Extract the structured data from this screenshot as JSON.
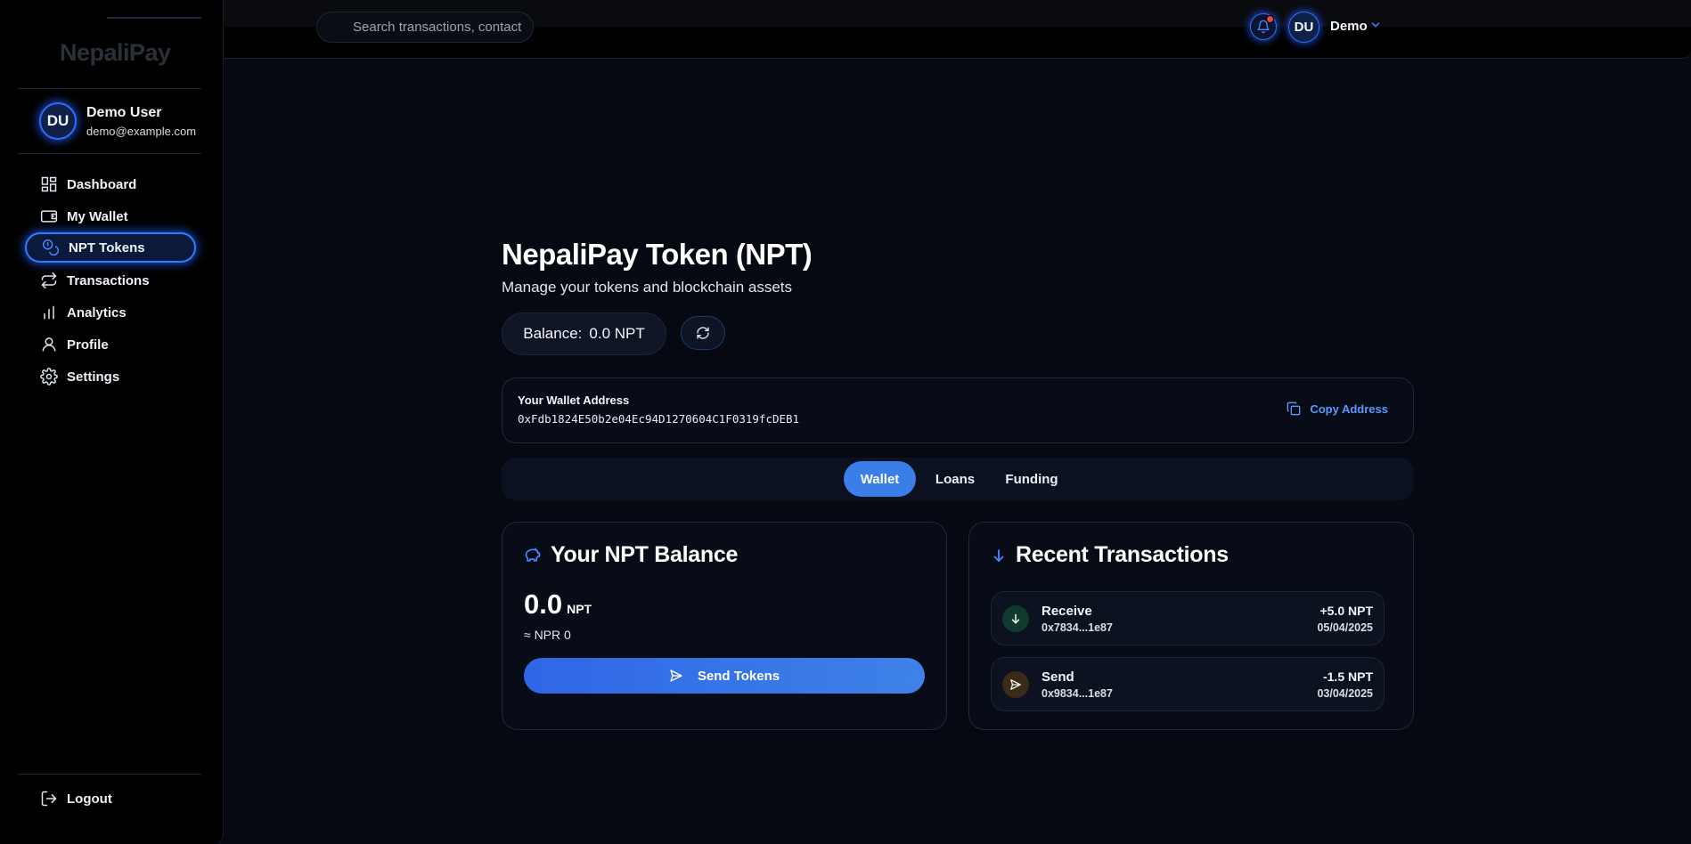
{
  "app": {
    "logo": "NepaliPay"
  },
  "header": {
    "search_placeholder": "Search transactions, contacts...",
    "avatar_initials": "DU",
    "user_name": "Demo"
  },
  "sidebar": {
    "user": {
      "initials": "DU",
      "name": "Demo User",
      "email": "demo@example.com"
    },
    "items": [
      {
        "label": "Dashboard",
        "icon": "dashboard-icon"
      },
      {
        "label": "My Wallet",
        "icon": "wallet-icon"
      },
      {
        "label": "NPT Tokens",
        "icon": "coins-icon",
        "active": true
      },
      {
        "label": "Transactions",
        "icon": "arrows-swap-icon"
      },
      {
        "label": "Analytics",
        "icon": "bar-chart-icon"
      },
      {
        "label": "Profile",
        "icon": "user-icon"
      },
      {
        "label": "Settings",
        "icon": "gear-icon"
      }
    ],
    "logout_label": "Logout"
  },
  "main": {
    "title": "NepaliPay Token (NPT)",
    "subtitle": "Manage your tokens and blockchain assets",
    "balance_label": "Balance:",
    "balance_value": "0.0 NPT",
    "wallet": {
      "label": "Your Wallet Address",
      "address": "0xFdb1824E50b2e04Ec94D1270604C1F0319fcDEB1",
      "copy_label": "Copy Address"
    },
    "tabs": [
      {
        "label": "Wallet",
        "active": true
      },
      {
        "label": "Loans"
      },
      {
        "label": "Funding"
      }
    ],
    "balance_card": {
      "title": "Your NPT Balance",
      "amount": "0.0",
      "unit": "NPT",
      "npr_equivalent": "≈ NPR 0",
      "send_label": "Send Tokens"
    },
    "transactions_card": {
      "title": "Recent Transactions",
      "items": [
        {
          "type": "Receive",
          "address": "0x7834...1e87",
          "amount": "+5.0 NPT",
          "date": "05/04/2025"
        },
        {
          "type": "Send",
          "address": "0x9834...1e87",
          "amount": "-1.5 NPT",
          "date": "03/04/2025"
        }
      ]
    }
  },
  "colors": {
    "accent": "#3b7ee8",
    "background": "#060912",
    "receive_badge": "#12392e",
    "send_badge": "#3a2a18",
    "notification_dot": "#e24646"
  }
}
